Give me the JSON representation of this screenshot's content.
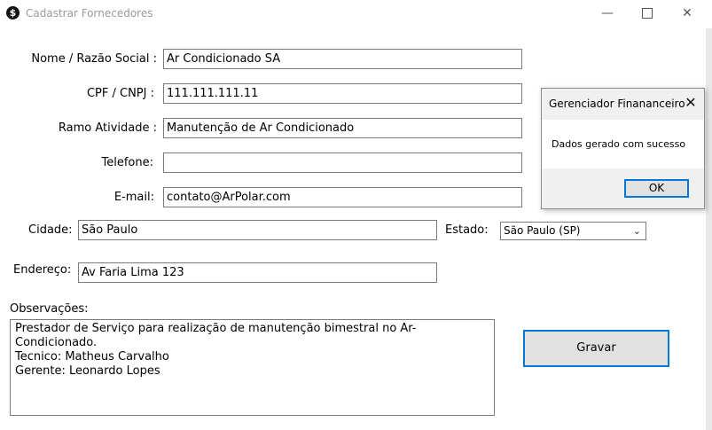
{
  "window": {
    "app_icon": "dollar-icon",
    "app_icon_glyph": "$",
    "title": "Cadastrar Fornecedores",
    "minimize_glyph": "—",
    "close_glyph": "✕"
  },
  "form": {
    "nome_label": "Nome / Razão Social :",
    "nome_value": "Ar Condicionado SA",
    "cpf_label": "CPF / CNPJ :",
    "cpf_value": "111.111.111.11",
    "ramo_label": "Ramo Atividade :",
    "ramo_value": "Manutenção de Ar Condicionado",
    "telefone_label": "Telefone:",
    "telefone_value": "",
    "email_label": "E-mail:",
    "email_value": "contato@ArPolar.com",
    "cidade_label": "Cidade:",
    "cidade_value": "São Paulo",
    "estado_label": "Estado:",
    "estado_value": "São Paulo (SP)",
    "estado_chevron": "⌄",
    "endereco_label": "Endereço:",
    "endereco_value": "Av Faria Lima 123",
    "observacoes_label": "Observações:",
    "observacoes_value": "Prestador de Serviço para realização de manutenção bimestral no Ar-\nCondicionado.\nTecnico: Matheus Carvalho\nGerente: Leonardo Lopes",
    "gravar_label": "Gravar"
  },
  "message_box": {
    "title": "Gerenciador Finananceiro",
    "close_glyph": "✕",
    "message": "Dados gerado com sucesso",
    "ok_label": "OK"
  },
  "colors": {
    "focus_border": "#0078d7",
    "button_bg": "#e1e1e1",
    "dialog_bg": "#f0f0f0"
  }
}
